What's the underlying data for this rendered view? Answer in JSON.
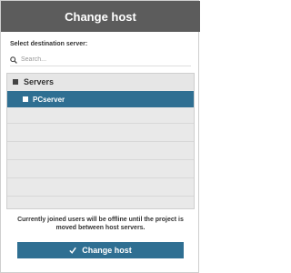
{
  "dialog": {
    "title": "Change host",
    "subtitle": "Select destination server:",
    "search": {
      "placeholder": "Search..."
    },
    "tree": {
      "items": [
        {
          "label": "Servers",
          "type": "group"
        },
        {
          "label": "PCserver",
          "type": "server",
          "selected": true
        }
      ]
    },
    "note": "Currently joined users will be offline until the project is moved between host servers.",
    "primary_button": {
      "label": "Change host",
      "icon": "check-icon"
    }
  },
  "colors": {
    "header_bg": "#5c5c5c",
    "accent": "#2f6f92",
    "tree_bg": "#e9e9e9"
  }
}
